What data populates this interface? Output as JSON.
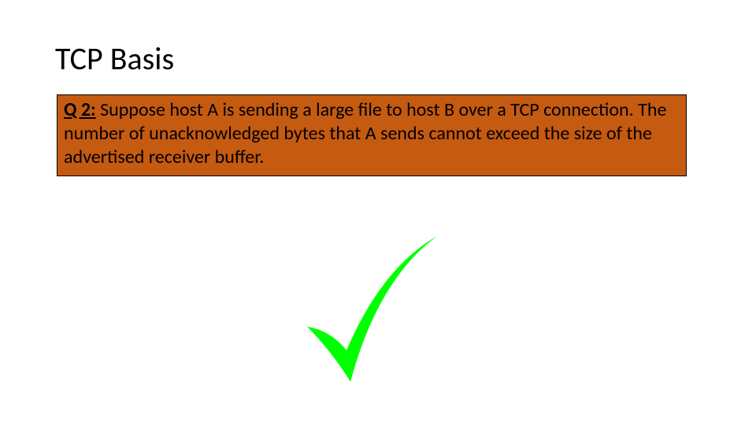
{
  "slide": {
    "title": "TCP Basis",
    "question_label": "Q 2:",
    "question_text": " Suppose host A is sending a large file to host B over a TCP connection. The number of unacknowledged bytes that A sends cannot exceed the size of the advertised receiver buffer.",
    "answer_icon": "checkmark",
    "colors": {
      "box_fill": "#c55a11",
      "check_fill": "#00ff00"
    }
  }
}
